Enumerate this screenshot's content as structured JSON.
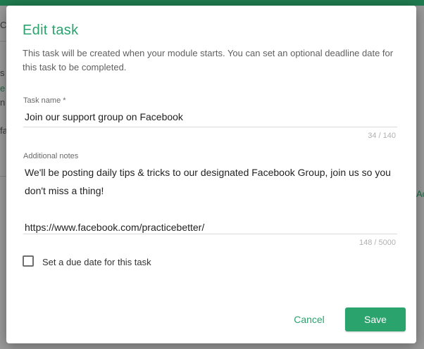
{
  "background": {
    "fragments": [
      "Co",
      "s",
      "e",
      "n",
      "fa",
      "Ad"
    ]
  },
  "dialog": {
    "title": "Edit task",
    "description": "This task will be created when your module starts. You can set an optional deadline date for this task to be completed.",
    "task_name": {
      "label": "Task name *",
      "value": "Join our support group on Facebook",
      "counter": "34 / 140"
    },
    "notes": {
      "label": "Additional notes",
      "line1": "We'll be posting daily tips & tricks to our designated Facebook Group, join us so you don't miss a thing!",
      "line2": "https://www.facebook.com/practicebetter/",
      "counter": "148 / 5000"
    },
    "due_date": {
      "label": "Set a due date for this task",
      "checked": false
    },
    "actions": {
      "cancel_label": "Cancel",
      "save_label": "Save"
    }
  },
  "colors": {
    "accent": "#2aa36c",
    "header_bar": "#1f7a4f",
    "overlay": "#9a9a9a"
  }
}
